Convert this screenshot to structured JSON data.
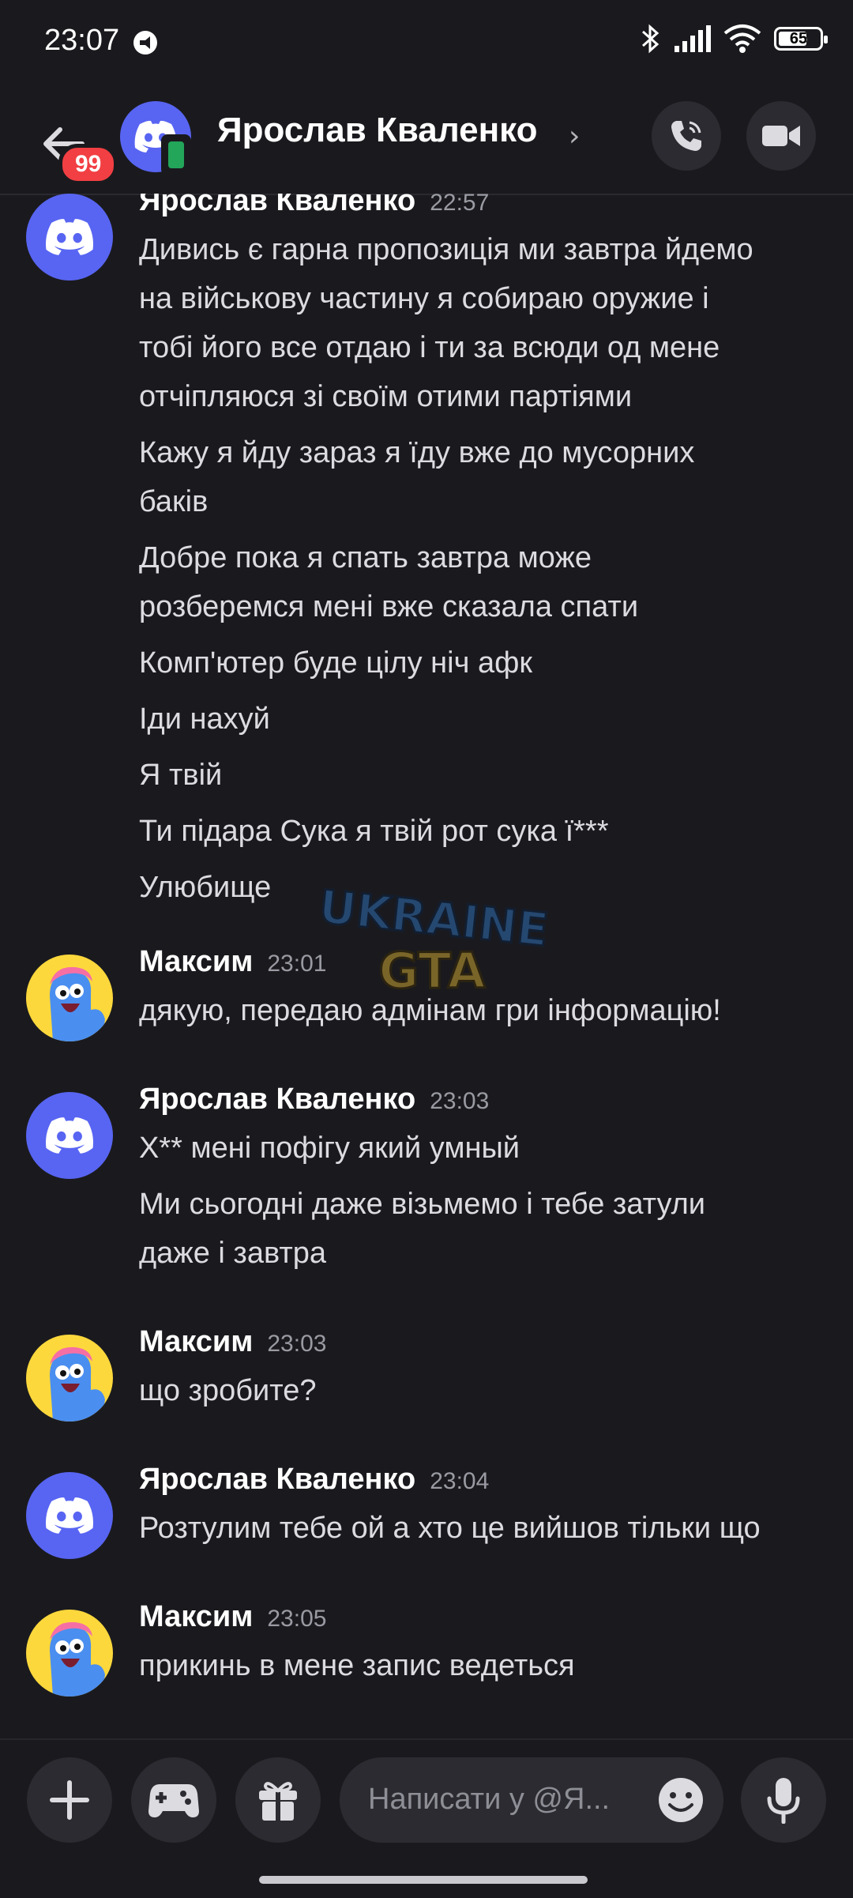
{
  "status_bar": {
    "time": "23:07",
    "battery": "65"
  },
  "header": {
    "title": "Ярослав Кваленко",
    "unread_badge": "99",
    "chevron": "›"
  },
  "messages": [
    {
      "author": "Ярослав Кваленко",
      "time": "22:57",
      "avatar": "discord-avatar",
      "lines": [
        "Дивись є гарна пропозиція ми завтра йдемо",
        "на військову частину я собираю оружие і",
        "тобі його все отдаю і ти за всюди од мене",
        "отчіпляюся зі своїм отими партіями",
        "Кажу я йду зараз я їду вже до мусорних",
        "баків",
        "Добре пока я спать завтра може",
        "розберемся мені вже сказала спати",
        "Комп'ютер буде цілу ніч афк",
        "Іди нахуй",
        "Я твій",
        "Ти підара Сука я твій рот сука ї***",
        "Улюбище"
      ]
    },
    {
      "author": "Максим",
      "time": "23:01",
      "avatar": "cartoon-avatar",
      "lines": [
        "дякую, передаю адмінам гри інформацію!"
      ]
    },
    {
      "author": "Ярослав Кваленко",
      "time": "23:03",
      "avatar": "discord-avatar",
      "lines": [
        "Х** мені пофігу який умный",
        "Ми сьогодні даже візьмемо і тебе затули",
        "даже і завтра"
      ]
    },
    {
      "author": "Максим",
      "time": "23:03",
      "avatar": "cartoon-avatar",
      "lines": [
        "що зробите?"
      ]
    },
    {
      "author": "Ярослав Кваленко",
      "time": "23:04",
      "avatar": "discord-avatar",
      "lines": [
        "Розтулим тебе ой а хто це вийшов тільки що"
      ]
    },
    {
      "author": "Максим",
      "time": "23:05",
      "avatar": "cartoon-avatar",
      "lines": [
        "прикинь в мене запис ведеться"
      ]
    }
  ],
  "watermark": {
    "line1": "UKRAINE",
    "line2": "GTA"
  },
  "composer": {
    "placeholder": "Написати у @Я..."
  },
  "colors": {
    "background": "#1a1a1e",
    "discord_blurple": "#5865f2",
    "badge_red": "#f23f43",
    "online_green": "#23a55a",
    "cartoon_yellow": "#fdd83c"
  }
}
